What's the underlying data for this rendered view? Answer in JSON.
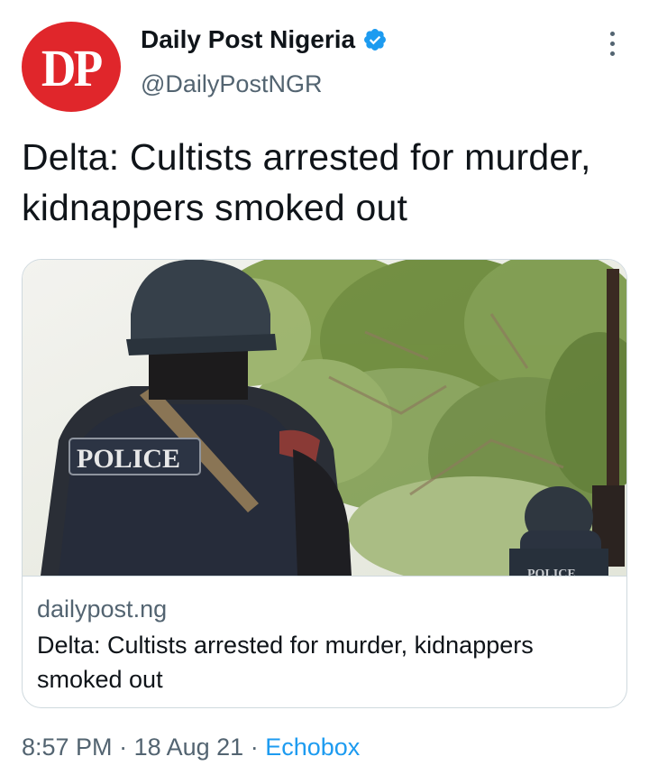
{
  "tweet": {
    "avatar_text": "DP",
    "display_name": "Daily Post Nigeria",
    "verified_icon": "verified-badge-icon",
    "handle": "@DailyPostNGR",
    "more_icon": "more-options-icon",
    "text": "Delta: Cultists arrested for murder, kidnappers smoked out"
  },
  "card": {
    "image_label": "POLICE",
    "domain": "dailypost.ng",
    "title": "Delta: Cultists arrested for murder, kidnappers smoked out"
  },
  "meta": {
    "time": "8:57 PM",
    "separator1": " · ",
    "date": "18 Aug 21",
    "separator2": " · ",
    "source": "Echobox"
  },
  "colors": {
    "avatar_bg": "#e0262b",
    "verified_blue": "#1d9bf0",
    "secondary_text": "#536471",
    "link_blue": "#1d9bf0"
  }
}
